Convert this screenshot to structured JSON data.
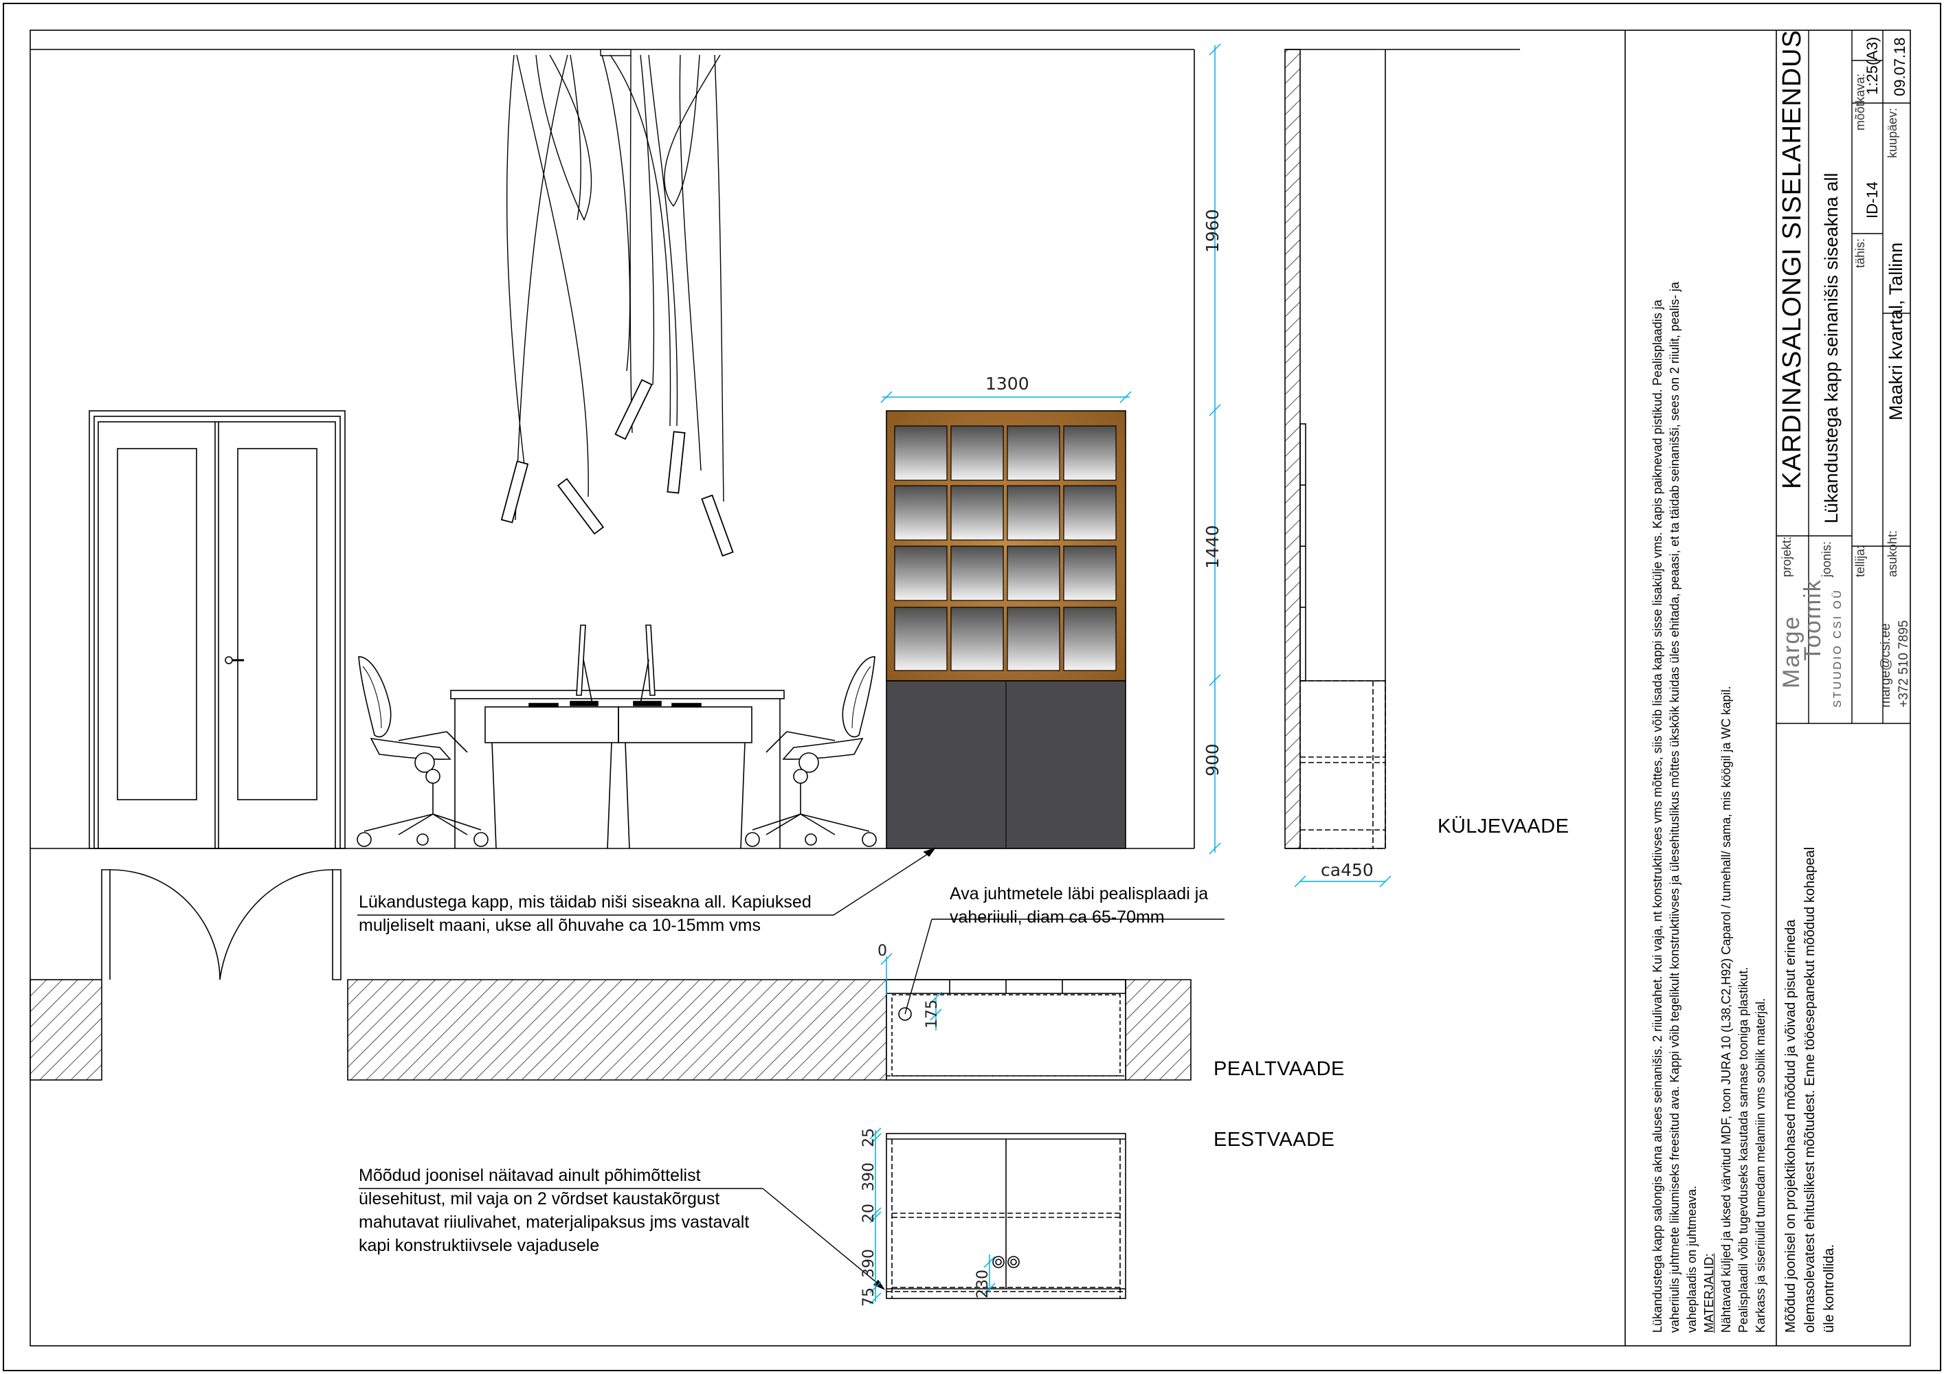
{
  "dimensions": {
    "total_height": "1960",
    "upper_height": "1440",
    "base_height": "900",
    "cabinet_width": "1300",
    "side_depth": "ca450",
    "top_zero": "0",
    "top_hole": "175",
    "front_25": "25",
    "front_390a": "390",
    "front_20": "20",
    "front_390b": "390",
    "front_75": "75",
    "front_230": "230"
  },
  "views": {
    "side": "KÜLJEVAADE",
    "top": "PEALTVAADE",
    "front": "EESTVAADE"
  },
  "callouts": {
    "cabinet": [
      "Lükandustega kapp, mis täidab niši siseakna all. Kapiuksed",
      "muljeliselt maani, ukse all õhuvahe ca 10-15mm vms"
    ],
    "hole": [
      "Ava juhtmetele läbi pealisplaadi ja",
      "vaheriiuli, diam ca 65-70mm"
    ],
    "dimensions_note": [
      "Mõõdud joonisel näitavad ainult põhimõttelist",
      "ülesehitust, mil vaja on 2 võrdset kaustakõrgust",
      "mahutavat riiulivahet, materjalipaksus jms vastavalt",
      "kapi konstruktiivsele vajadusele"
    ]
  },
  "description": [
    "Lükandustega kapp salongis akna aluses seinanišis. 2 riiulivahet. Kui vaja, nt konstruktiivses vms  mõttes, siis võib lisada kappi sisse lisakülje vms. Kapis paiknevad pistikud. Pealisplaadis ja",
    "vaheriiulis juhtmete liikumiseks freesitud ava. Kappi võib tegelikult konstruktiivses ja ülesehituslikus mõttes ükskõik kuidas üles ehitada, peaasi, et ta täidab seinanišši, sees on 2 riiulit, pealis- ja",
    "vaheplaadis on juhtmeava.",
    "MATERJALID:",
    "Nähtavad küljed ja uksed värvitud MDF, toon JURA 10 (L38,C2,H92) Caparol / tumehall/ sama, mis köögil ja WC kapil.",
    "Pealisplaadil võib tugevduseks kasutada sarnase tooniga plastikut.",
    "Karkass ja siseriiulid tumedam melamiin vms sobilik materjal."
  ],
  "disclaimer": [
    "Mõõdud joonisel on projektikohased mõõdud ja võivad pisut erineda",
    "olemasolevatest ehituslikest mõõtudest. Enne tööesepanekut mõõdud kohapeal",
    "üle kontrollida."
  ],
  "title_block": {
    "logo_name_1": "Marge",
    "logo_name_2": "Toomik",
    "studio": "STUUDIO CSI OÜ",
    "email": "marge@csi.ee",
    "phone": "+372 510 7895",
    "projekt_label": "projekt:",
    "projekt": "KARDINASALONGI SISELAHENDUS",
    "joonis_label": "joonis:",
    "joonis": "Lükandustega kapp seinanišis siseakna all",
    "tellija_label": "tellija:",
    "tahis_label": "tähis:",
    "tahis": "ID-14",
    "mootkava_label": "mõõtkava:",
    "mootkava": "1:25(A3)",
    "asukoht_label": "asukoht:",
    "asukoht": "Maakri kvartal, Tallinn",
    "kuupaev_label": "kuupäev:",
    "kuupaev": "09.07.18"
  },
  "colors": {
    "dimension": "#00aee8",
    "cabinet_base": "#4a4a4d",
    "wood_frame": "#a8702c"
  }
}
